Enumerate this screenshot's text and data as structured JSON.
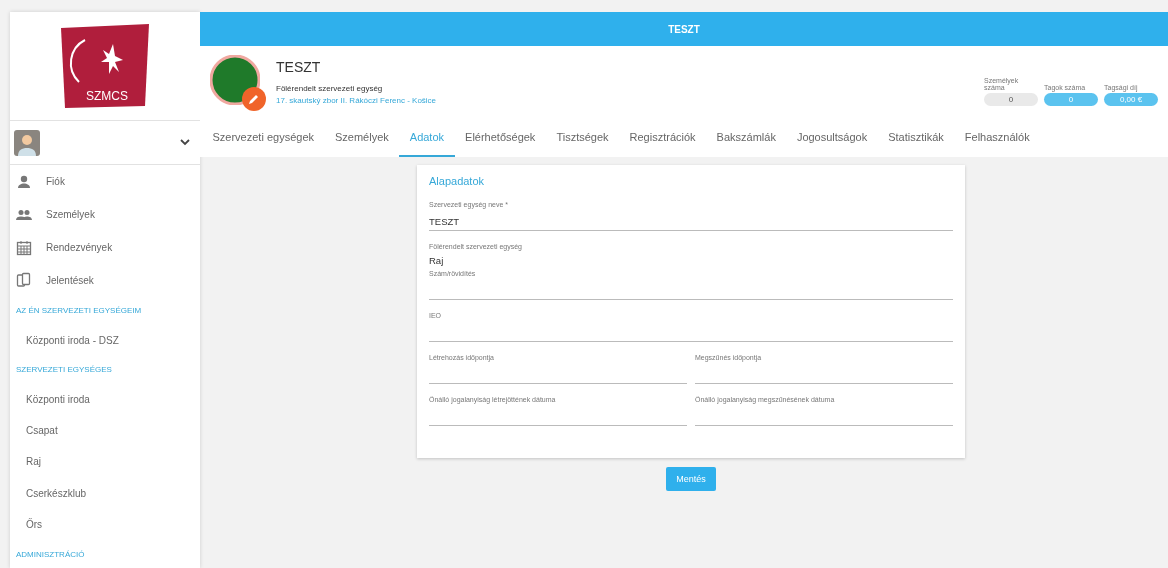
{
  "logo": {
    "text": "SZMCS"
  },
  "header": {
    "title": "TESZT"
  },
  "unit": {
    "name": "TESZT",
    "parent_label": "Fölérendelt szervezeti egység",
    "parent_link": "17. skautský zbor II. Rákóczi Ferenc - Košice"
  },
  "stats": [
    {
      "label": "Személyek száma",
      "value": "0",
      "color": "#e9e9e9"
    },
    {
      "label": "Tagok száma",
      "value": "0",
      "color": "#5bc3ef"
    },
    {
      "label": "Tagsági díj",
      "value": "0,00 €",
      "color": "#5bc3ef"
    }
  ],
  "tabs": [
    {
      "label": "Szervezeti egységek",
      "selected": false
    },
    {
      "label": "Személyek",
      "selected": false
    },
    {
      "label": "Adatok",
      "selected": true
    },
    {
      "label": "Elérhetőségek",
      "selected": false
    },
    {
      "label": "Tisztségek",
      "selected": false
    },
    {
      "label": "Regisztrációk",
      "selected": false
    },
    {
      "label": "Bakszámlák",
      "selected": false
    },
    {
      "label": "Jogosultságok",
      "selected": false
    },
    {
      "label": "Statisztikák",
      "selected": false
    },
    {
      "label": "Felhasználók",
      "selected": false
    }
  ],
  "sidebar": {
    "items": [
      {
        "kind": "nav",
        "label": "Fiók"
      },
      {
        "kind": "nav",
        "label": "Személyek"
      },
      {
        "kind": "nav",
        "label": "Rendezvények"
      },
      {
        "kind": "nav",
        "label": "Jelentések"
      },
      {
        "kind": "heading",
        "label": "AZ ÉN SZERVEZETI EGYSÉGEIM"
      },
      {
        "kind": "sub",
        "label": "Központi iroda - DSZ"
      },
      {
        "kind": "heading",
        "label": "SZERVEZETI EGYSÉGES"
      },
      {
        "kind": "sub",
        "label": "Központi iroda"
      },
      {
        "kind": "sub",
        "label": "Csapat"
      },
      {
        "kind": "sub",
        "label": "Raj"
      },
      {
        "kind": "sub",
        "label": "Cserkészklub"
      },
      {
        "kind": "sub",
        "label": "Őrs"
      },
      {
        "kind": "heading",
        "label": "ADMINISZTRÁCIÓ"
      }
    ]
  },
  "form": {
    "title": "Alapadatok",
    "rows": [
      [
        {
          "label": "Szervezeti egység neve *",
          "value": "TESZT",
          "kind": "input"
        }
      ],
      [
        {
          "label": "Fölérendelt szervezeti egység",
          "value": "Raj",
          "kind": "static"
        }
      ],
      [
        {
          "label": "Szám/rövidítés",
          "kind": "input"
        }
      ],
      [
        {
          "label": "IEO",
          "kind": "input"
        }
      ],
      [
        {
          "label": "Létrehozás időpontja",
          "kind": "input"
        },
        {
          "label": "Megszűnés időpontja",
          "kind": "input"
        }
      ],
      [
        {
          "label": "Önálló jogalanyiság létrejöttének dátuma",
          "kind": "input"
        },
        {
          "label": "Önálló jogalanyiság megszűnésének dátuma",
          "kind": "input"
        }
      ]
    ]
  },
  "save_button": "Mentés"
}
